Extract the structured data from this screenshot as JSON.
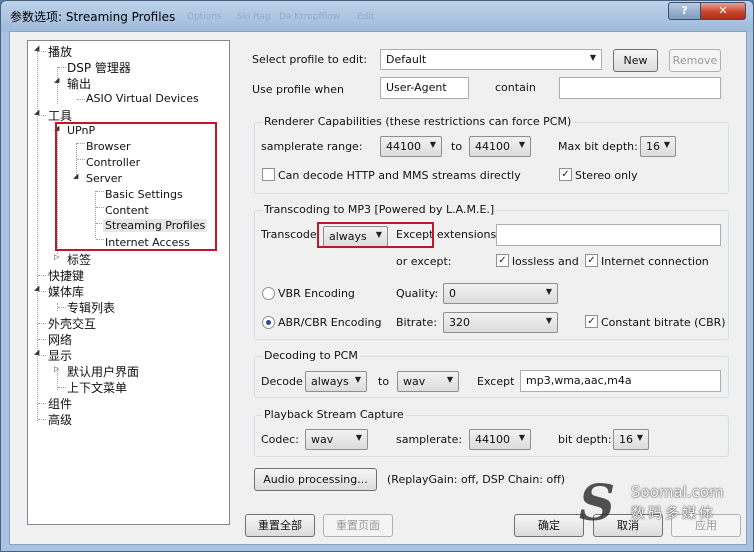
{
  "window": {
    "title": "参数选项: Streaming Profiles",
    "help_label": "?",
    "close_label": "✕",
    "ghost_tabs": [
      "Options",
      "Ski Rag",
      "Da Ktropfflow",
      "Edit"
    ]
  },
  "tree": {
    "items": [
      {
        "label": "播放",
        "expander": "expanded"
      },
      {
        "label": "DSP 管理器"
      },
      {
        "label": "输出",
        "expander": "expanded"
      },
      {
        "label": "ASIO Virtual Devices"
      },
      {
        "label": "工具",
        "expander": "expanded"
      },
      {
        "label": "UPnP",
        "expander": "expanded"
      },
      {
        "label": "Browser"
      },
      {
        "label": "Controller"
      },
      {
        "label": "Server",
        "expander": "expanded"
      },
      {
        "label": "Basic Settings"
      },
      {
        "label": "Content"
      },
      {
        "label": "Streaming Profiles",
        "selected": true
      },
      {
        "label": "Internet Access"
      },
      {
        "label": "标签",
        "expander": "collapsed"
      },
      {
        "label": "快捷键"
      },
      {
        "label": "媒体库",
        "expander": "expanded"
      },
      {
        "label": "专辑列表"
      },
      {
        "label": "外壳交互"
      },
      {
        "label": "网络"
      },
      {
        "label": "显示",
        "expander": "expanded"
      },
      {
        "label": "默认用户界面",
        "expander": "collapsed"
      },
      {
        "label": "上下文菜单"
      },
      {
        "label": "组件"
      },
      {
        "label": "高级"
      }
    ]
  },
  "profile": {
    "select_label": "Select profile to edit:",
    "selected_profile": "Default",
    "new_label": "New",
    "remove_label": "Remove",
    "use_when_label": "Use profile when",
    "use_when_value": "User-Agent",
    "contain_label": "contain",
    "contain_value": ""
  },
  "renderer": {
    "title": "Renderer Capabilities (these restrictions can force PCM)",
    "samplerate_label": "samplerate range:",
    "samplerate_from": "44100",
    "to_label": "to",
    "samplerate_to": "44100",
    "bitdepth_label": "Max bit depth:",
    "bitdepth_value": "16",
    "http_mms_label": "Can decode  HTTP and MMS  streams directly",
    "http_mms_checked": false,
    "stereo_label": "Stereo only",
    "stereo_checked": true
  },
  "transcoding": {
    "title": "Transcoding to MP3 [Powered by L.A.M.E.]",
    "transcode_label": "Transcode",
    "transcode_value": "always",
    "except_label": "Except extensions",
    "except_value": "",
    "or_except_label": "or except:",
    "lossless_label": "lossless and",
    "lossless_checked": true,
    "internet_label": "Internet connection",
    "internet_checked": true,
    "vbr_label": "VBR Encoding",
    "vbr_selected": false,
    "quality_label": "Quality:",
    "quality_value": "0",
    "abr_label": "ABR/CBR Encoding",
    "abr_selected": true,
    "bitrate_label": "Bitrate:",
    "bitrate_value": "320",
    "cbr_label": "Constant bitrate (CBR)",
    "cbr_checked": true
  },
  "decoding": {
    "title": "Decoding to PCM",
    "decode_label": "Decode",
    "decode_value": "always",
    "to_label": "to",
    "to_value": "wav",
    "except_label": "Except",
    "except_value": "mp3,wma,aac,m4a"
  },
  "playback": {
    "title": "Playback Stream Capture",
    "codec_label": "Codec:",
    "codec_value": "wav",
    "samplerate_label": "samplerate:",
    "samplerate_value": "44100",
    "bitdepth_label": "bit depth:",
    "bitdepth_value": "16"
  },
  "audio_processing": {
    "button_label": "Audio processing...",
    "status": "(ReplayGain: off, DSP Chain: off)"
  },
  "footer": {
    "reset_all": "重置全部",
    "reset_page": "重置页面",
    "ok": "确定",
    "cancel": "取消",
    "apply": "应用"
  },
  "watermark": {
    "mark": "S",
    "site": "Soomal.com",
    "tagline": "数码多媒体"
  },
  "colors": {
    "highlight_red": "#c0182b",
    "title_bar": "#9fbbdb",
    "close_button": "#c7452e"
  }
}
